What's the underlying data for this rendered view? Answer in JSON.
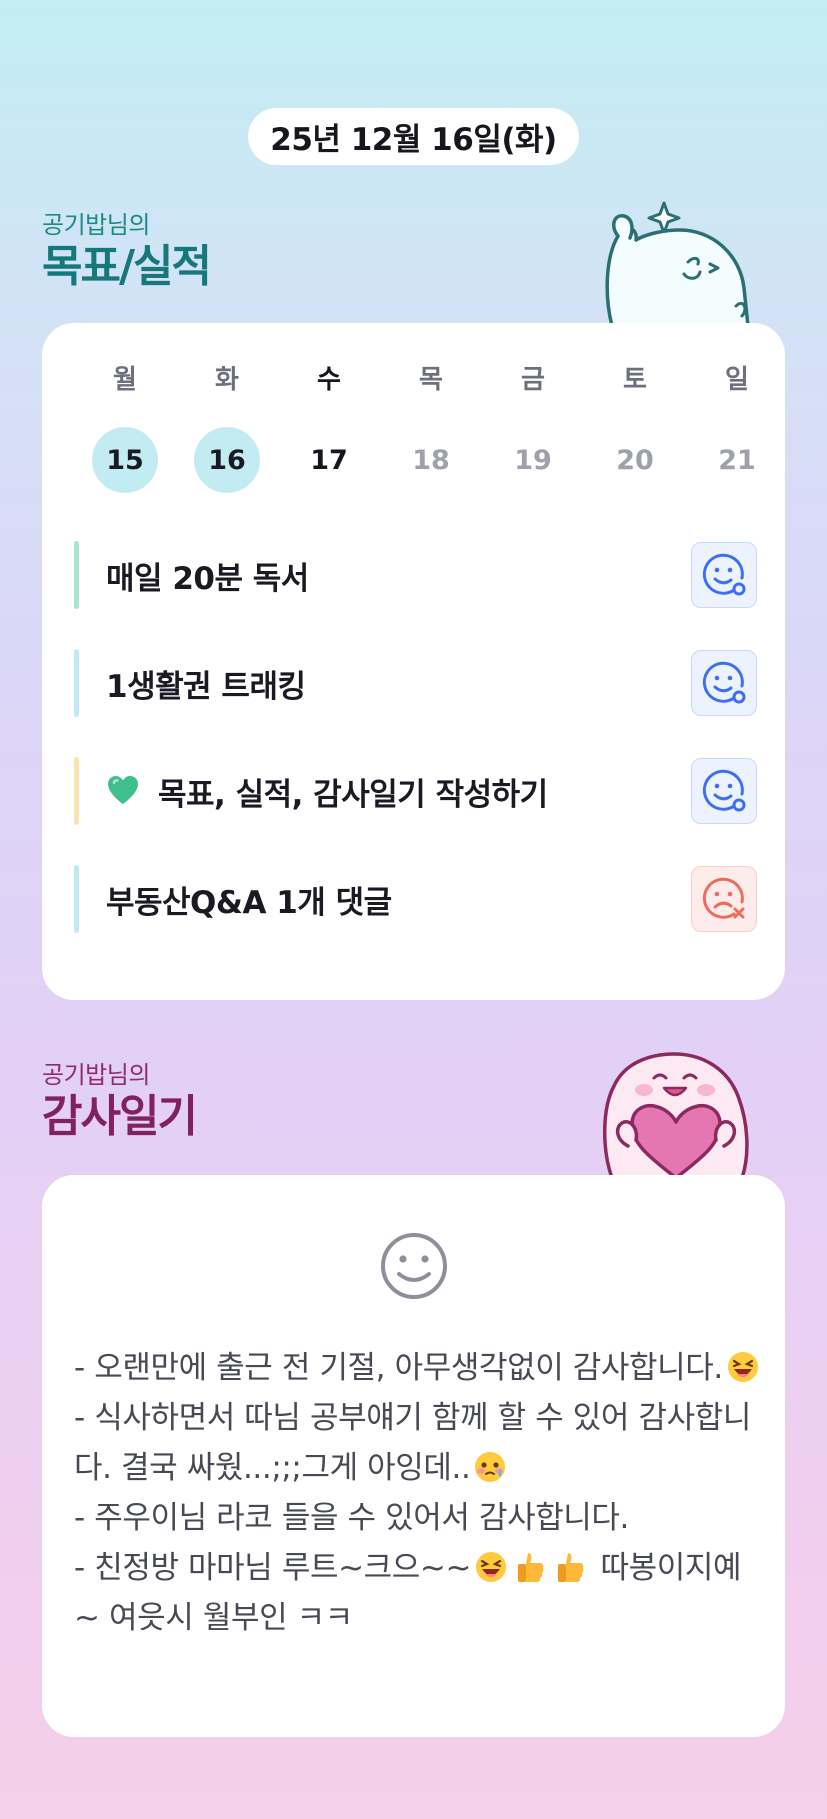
{
  "header": {
    "date": "25년 12월 16일(화)"
  },
  "goals_section": {
    "subtitle": "공기밥님의",
    "title": "목표/실적",
    "weekdays": [
      "월",
      "화",
      "수",
      "목",
      "금",
      "토",
      "일"
    ],
    "dates": [
      "15",
      "16",
      "17",
      "18",
      "19",
      "20",
      "21"
    ],
    "today_index": 2,
    "completed_indices": [
      0,
      1
    ],
    "items": [
      {
        "label": "매일 20분 독서",
        "bar_color": "#a8e4d3",
        "status": "done",
        "emoji": ""
      },
      {
        "label": "1생활권 트래킹",
        "bar_color": "#bfeaf1",
        "status": "done",
        "emoji": ""
      },
      {
        "label": "목표, 실적, 감사일기 작성하기",
        "bar_color": "#fbe2b1",
        "status": "done",
        "emoji": "green-heart-icon"
      },
      {
        "label": "부동산Q&A 1개 댓글",
        "bar_color": "#bfeaf1",
        "status": "failed",
        "emoji": ""
      }
    ]
  },
  "diary_section": {
    "subtitle": "공기밥님의",
    "title": "감사일기",
    "lines": [
      {
        "text": "- 오랜만에 출근 전 기절, 아무생각없이 감사합니다.",
        "emojis": [
          "grinning-squint-emoji"
        ]
      },
      {
        "text": "- 식사하면서 따님 공부얘기 함께 할 수 있어 감사합니다. 결국 싸웠...;;;그게 아잉데..",
        "emojis": [
          "blushing-tear-emoji"
        ]
      },
      {
        "text": "- 주우이님 라코 들을 수 있어서 감사합니다.",
        "emojis": []
      },
      {
        "text": "- 친정방 마마님 루트~크으~~",
        "emojis": [
          "grinning-squint-emoji",
          "thumbs-up-emoji",
          "thumbs-up-emoji"
        ],
        "tail": " 따봉이지예~ 여읏시 월부인 ㅋㅋ"
      }
    ]
  },
  "colors": {
    "accent_teal": "#17777a",
    "accent_plum": "#82215f",
    "done_blue": "#3d6ff0",
    "fail_red": "#ee6a5e"
  }
}
